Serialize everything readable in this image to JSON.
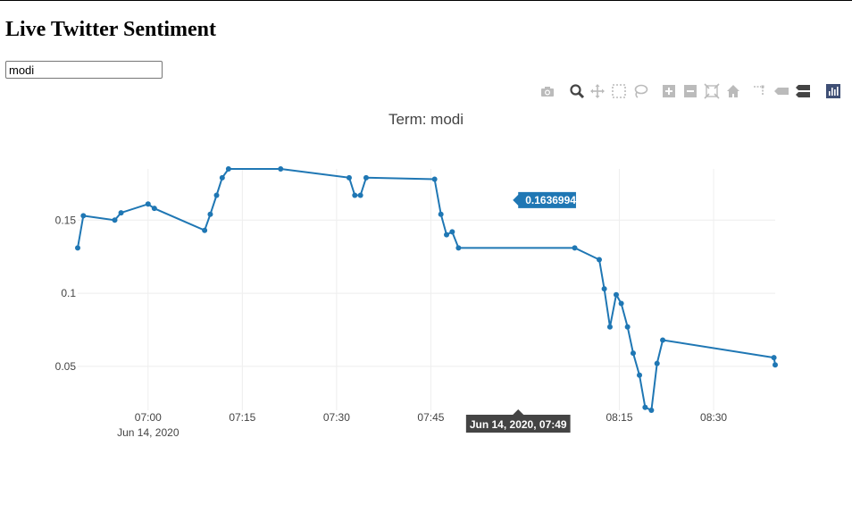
{
  "page": {
    "title": "Live Twitter Sentiment",
    "search": {
      "value": "modi"
    }
  },
  "modebar": {
    "buttons": [
      {
        "name": "camera-icon"
      },
      {
        "name": "zoom-icon"
      },
      {
        "name": "pan-icon"
      },
      {
        "name": "box-select-icon"
      },
      {
        "name": "lasso-select-icon"
      },
      {
        "name": "zoom-in-icon"
      },
      {
        "name": "zoom-out-icon"
      },
      {
        "name": "autoscale-icon"
      },
      {
        "name": "reset-axes-icon"
      },
      {
        "name": "spike-lines-icon"
      },
      {
        "name": "hover-closest-icon"
      },
      {
        "name": "hover-compare-icon"
      },
      {
        "name": "plotly-logo-icon"
      }
    ],
    "active_color": "#444444",
    "inactive_color": "#bbbbbb",
    "logo_color": "#3f4f75"
  },
  "chart_data": {
    "type": "line",
    "title": "Term: modi",
    "x_unit": "minutes",
    "x_ticks": [
      {
        "minute": 420,
        "label": "07:00",
        "sublabel": "Jun 14, 2020"
      },
      {
        "minute": 435,
        "label": "07:15"
      },
      {
        "minute": 450,
        "label": "07:30"
      },
      {
        "minute": 465,
        "label": "07:45"
      },
      {
        "minute": 495,
        "label": "08:15"
      },
      {
        "minute": 510,
        "label": "08:30"
      }
    ],
    "y_ticks": [
      {
        "value": 0.05,
        "label": "0.05"
      },
      {
        "value": 0.1,
        "label": "0.1"
      },
      {
        "value": 0.15,
        "label": "0.15"
      }
    ],
    "xlim": [
      408.8,
      519.8
    ],
    "ylim": [
      0.02,
      0.185
    ],
    "grid": true,
    "line_color": "#1f77b4",
    "series": [
      {
        "x": [
          408.8,
          409.7,
          414.7,
          415.7,
          420.0,
          421.0,
          429.0,
          429.9,
          430.9,
          431.8,
          432.8,
          441.1,
          452.0,
          452.9,
          453.8,
          454.7,
          465.6,
          466.6,
          467.5,
          468.4,
          469.4,
          487.9,
          491.8,
          492.6,
          493.5,
          494.5,
          495.3,
          496.3,
          497.2,
          498.2,
          499.1,
          500.1,
          501.0,
          501.9,
          519.6,
          520.5
        ],
        "y": [
          0.131,
          0.153,
          0.15,
          0.155,
          0.161,
          0.158,
          0.143,
          0.154,
          0.167,
          0.179,
          0.185,
          0.185,
          0.179,
          0.167,
          0.167,
          0.179,
          0.178,
          0.154,
          0.14,
          0.142,
          0.131,
          0.131,
          0.123,
          0.103,
          0.077,
          0.099,
          0.093,
          0.077,
          0.059,
          0.044,
          0.022,
          0.02,
          0.052,
          0.068,
          0.056,
          0.051
        ]
      }
    ],
    "hover": {
      "y_label": "0.1636994",
      "x_label": "Jun 14, 2020, 07:49",
      "x_minute": 478.9,
      "y_value": 0.1636994
    }
  }
}
